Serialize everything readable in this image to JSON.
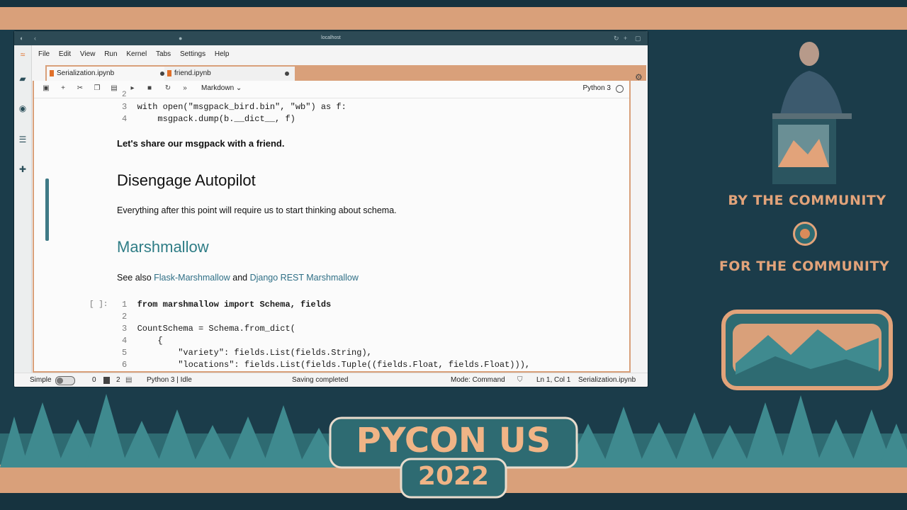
{
  "browser": {
    "url": "localhost"
  },
  "menu": [
    "File",
    "Edit",
    "View",
    "Run",
    "Kernel",
    "Tabs",
    "Settings",
    "Help"
  ],
  "tabs": [
    {
      "label": "Serialization.ipynb"
    },
    {
      "label": "friend.ipynb"
    }
  ],
  "toolbar": {
    "cell_type": "Markdown",
    "kernel": "Python 3"
  },
  "cells": {
    "code1": {
      "lines": [
        {
          "n": "2",
          "text": ""
        },
        {
          "n": "3",
          "text": "with open(\"msgpack_bird.bin\", \"wb\") as f:"
        },
        {
          "n": "4",
          "text": "    msgpack.dump(b.__dict__, f)"
        }
      ]
    },
    "md1": "Let's share our msgpack with a friend.",
    "md2_heading": "Disengage Autopilot",
    "md2_body": "Everything after this point will require us to start thinking about schema.",
    "md3_heading": "Marshmallow",
    "md4_prefix": "See also ",
    "md4_link1": "Flask-Marshmallow",
    "md4_and": " and ",
    "md4_link2": "Django REST Marshmallow",
    "code2": {
      "prompt": "[ ]:",
      "lines": [
        {
          "n": "1",
          "text": "from marshmallow import Schema, fields"
        },
        {
          "n": "2",
          "text": ""
        },
        {
          "n": "3",
          "text": "CountSchema = Schema.from_dict("
        },
        {
          "n": "4",
          "text": "    {"
        },
        {
          "n": "5",
          "text": "        \"variety\": fields.List(fields.String),"
        },
        {
          "n": "6",
          "text": "        \"locations\": fields.List(fields.Tuple((fields.Float, fields.Float))),"
        }
      ]
    }
  },
  "status": {
    "mode_label": "Simple",
    "count1": "0",
    "count2": "2",
    "kernel_state": "Python 3 | Idle",
    "save_state": "Saving completed",
    "mode": "Mode: Command",
    "cursor": "Ln 1, Col 1",
    "file": "Serialization.ipynb"
  },
  "stage": {
    "line1": "BY THE COMMUNITY",
    "line2": "FOR THE COMMUNITY",
    "event": "PYCON US",
    "year": "2022"
  },
  "colors": {
    "accent": "#d9a07a",
    "teal": "#2e6b72",
    "dark": "#1b3c4a"
  }
}
